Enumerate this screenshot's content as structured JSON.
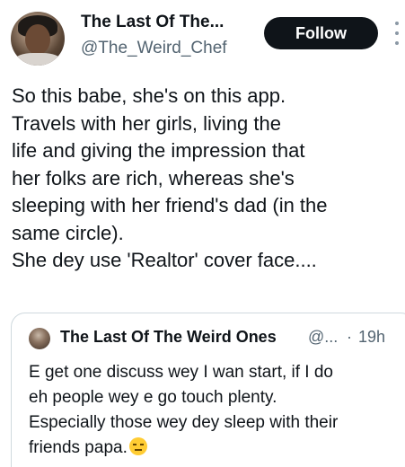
{
  "author": {
    "display_name": "The Last Of The...",
    "handle": "@The_Weird_Chef",
    "avatar_icon": "profile-photo"
  },
  "actions": {
    "follow_label": "Follow",
    "more_icon": "more-vertical-icon"
  },
  "tweet": {
    "lines": [
      "So this babe, she's on this app.",
      "Travels with her girls, living the",
      "life and giving the impression that",
      "her folks are rich, whereas she's",
      "sleeping with her friend's dad (in the",
      "same circle).",
      "She dey use 'Realtor' cover face...."
    ]
  },
  "quoted_tweet": {
    "display_name": "The Last Of The Weird Ones",
    "handle": "@...",
    "separator": "·",
    "time": "19h",
    "lines": [
      "E get one discuss wey I wan start, if I do",
      "eh people wey e go touch plenty.",
      "Especially those wey dey sleep with their",
      "friends papa."
    ],
    "emoji": "expressionless-face-emoji"
  },
  "colors": {
    "text_primary": "#0f1419",
    "text_secondary": "#536471",
    "follow_bg": "#0f1419",
    "card_border": "#cfd9de"
  }
}
